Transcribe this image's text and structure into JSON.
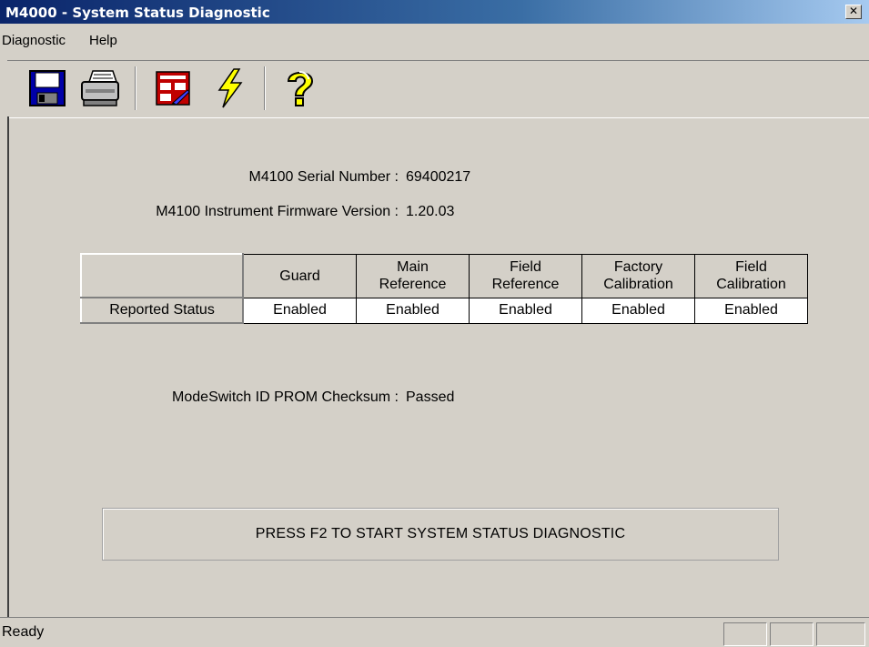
{
  "window": {
    "title": "M4000 - System Status Diagnostic",
    "close_glyph": "✕"
  },
  "menu": {
    "items": [
      "Diagnostic",
      "Help"
    ]
  },
  "toolbar": {
    "icons": [
      "save-icon",
      "print-icon",
      "calendar-edit-icon",
      "lightning-icon",
      "help-icon"
    ]
  },
  "info": {
    "serial_label": "M4100 Serial Number :",
    "serial_value": "69400217",
    "firmware_label": "M4100 Instrument Firmware Version :",
    "firmware_value": "1.20.03",
    "checksum_label": "ModeSwitch ID PROM Checksum :",
    "checksum_value": "Passed"
  },
  "status_table": {
    "columns": [
      {
        "line1": "Guard",
        "line2": ""
      },
      {
        "line1": "Main",
        "line2": "Reference"
      },
      {
        "line1": "Field",
        "line2": "Reference"
      },
      {
        "line1": "Factory",
        "line2": "Calibration"
      },
      {
        "line1": "Field",
        "line2": "Calibration"
      }
    ],
    "row_label": "Reported Status",
    "values": [
      "Enabled",
      "Enabled",
      "Enabled",
      "Enabled",
      "Enabled"
    ]
  },
  "action": {
    "label": "PRESS F2 TO START SYSTEM STATUS DIAGNOSTIC"
  },
  "statusbar": {
    "text": "Ready"
  }
}
